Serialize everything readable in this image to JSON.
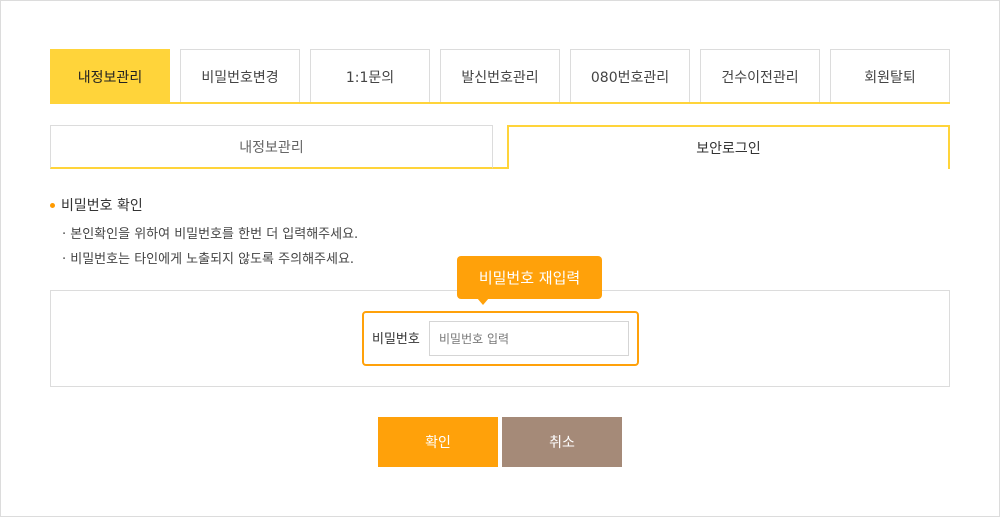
{
  "tabs": [
    {
      "label": "내정보관리",
      "active": true
    },
    {
      "label": "비밀번호변경",
      "active": false
    },
    {
      "label": "1:1문의",
      "active": false
    },
    {
      "label": "발신번호관리",
      "active": false
    },
    {
      "label": "080번호관리",
      "active": false
    },
    {
      "label": "건수이전관리",
      "active": false
    },
    {
      "label": "회원탈퇴",
      "active": false
    }
  ],
  "subtabs": [
    {
      "label": "내정보관리",
      "active": false
    },
    {
      "label": "보안로그인",
      "active": true
    }
  ],
  "section": {
    "title": "비밀번호 확인",
    "lines": [
      "· 본인확인을 위하여 비밀번호를 한번 더 입력해주세요.",
      "· 비밀번호는 타인에게 노출되지 않도록 주의해주세요."
    ]
  },
  "form": {
    "password_label": "비밀번호",
    "password_placeholder": "비밀번호 입력",
    "password_value": "",
    "tooltip": "비밀번호 재입력"
  },
  "buttons": {
    "confirm": "확인",
    "cancel": "취소"
  },
  "colors": {
    "accent_yellow": "#ffd43a",
    "accent_orange": "#ffa10a",
    "cancel_brown": "#a58a78"
  }
}
